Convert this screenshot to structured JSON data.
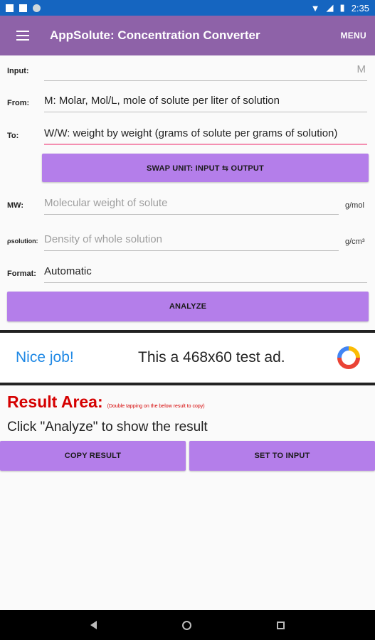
{
  "status_bar": {
    "time": "2:35"
  },
  "app_bar": {
    "title": "AppSolute: Concentration Converter",
    "menu_label": "MENU"
  },
  "form": {
    "input_label": "Input:",
    "input_value": "M",
    "from_label": "From:",
    "from_value": "M: Molar, Mol/L, mole of solute per liter of solution",
    "to_label": "To:",
    "to_value": "W/W: weight by weight (grams of solute per grams of solution)",
    "swap_label": "SWAP UNIT: INPUT ⇆ OUTPUT",
    "mw_label": "MW:",
    "mw_placeholder": "Molecular weight of solute",
    "mw_unit": "g/mol",
    "density_label": "ρsolution:",
    "density_placeholder": "Density of whole solution",
    "density_unit": "g/cm³",
    "format_label": "Format:",
    "format_value": "Automatic",
    "analyze_label": "ANALYZE"
  },
  "ad": {
    "nice": "Nice job!",
    "text": "This a 468x60 test ad."
  },
  "result": {
    "title": "Result Area:",
    "hint": "(Double tapping on the below result to copy)",
    "text": "Click \"Analyze\" to show the result",
    "copy_label": "COPY RESULT",
    "set_input_label": "SET TO INPUT"
  },
  "colors": {
    "app_bar": "#8e62a8",
    "status_bar": "#1565c0",
    "button": "#b47eea",
    "result_red": "#d50000",
    "ad_blue": "#1e88e5"
  },
  "icons": [
    "menu-icon",
    "wifi-icon",
    "signal-icon",
    "battery-icon",
    "back-icon",
    "home-icon",
    "recents-icon",
    "ad-logo-icon"
  ]
}
